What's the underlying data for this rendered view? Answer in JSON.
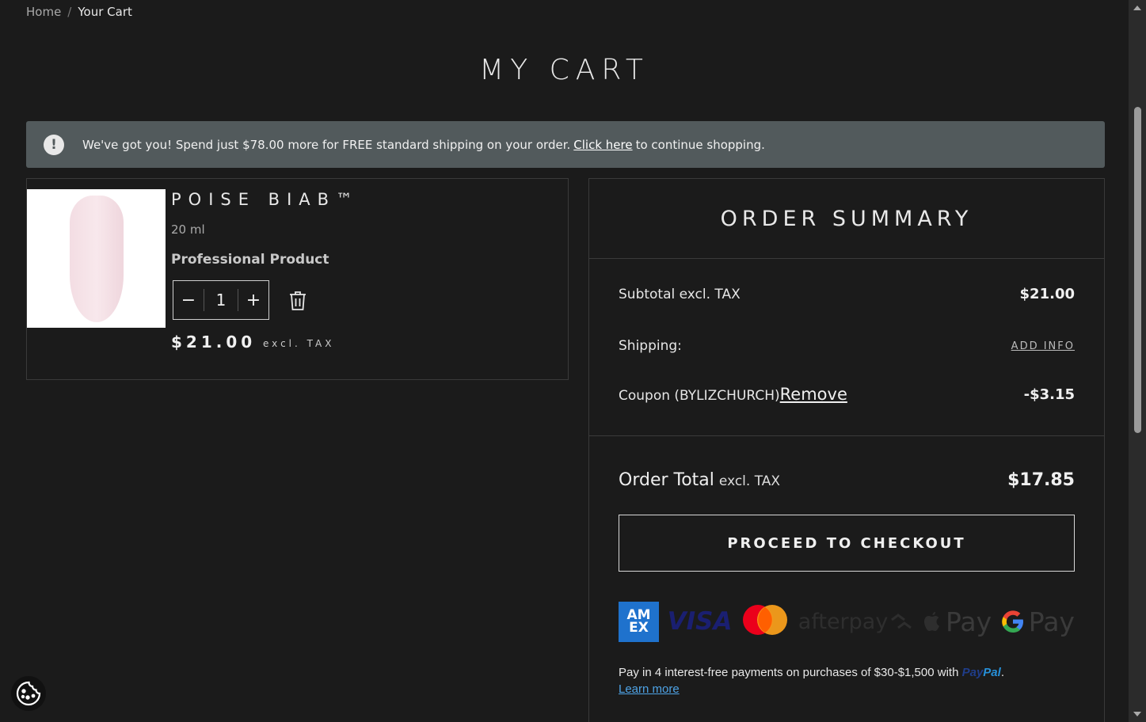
{
  "breadcrumb": {
    "home": "Home",
    "separator": "/",
    "current": "Your Cart"
  },
  "page": {
    "title": "MY CART"
  },
  "notice": {
    "icon": "exclamation-icon",
    "text_before": "We've got you! Spend just $78.00 more for FREE standard shipping on your order.",
    "link_text": "Click here",
    "text_after": "to continue shopping."
  },
  "cart": {
    "items": [
      {
        "name": "POISE BIAB™",
        "size": "20 ml",
        "type": "Professional Product",
        "quantity": "1",
        "decrement": "−",
        "increment": "+",
        "price": "$21.00",
        "price_note": "excl. TAX"
      }
    ]
  },
  "summary": {
    "title": "ORDER SUMMARY",
    "subtotal_label": "Subtotal excl. TAX",
    "subtotal_value": "$21.00",
    "shipping_label": "Shipping:",
    "shipping_action": "ADD INFO",
    "coupon_label": "Coupon (BYLIZCHURCH)",
    "coupon_remove": "Remove",
    "coupon_value": "-$3.15",
    "total_label": "Order Total",
    "total_note": "excl. TAX",
    "total_value": "$17.85",
    "checkout_label": "PROCEED TO CHECKOUT"
  },
  "payments": {
    "amex": "AM EX",
    "visa": "VISA",
    "afterpay": "afterpay",
    "applepay": "Pay",
    "gpay": "Pay",
    "paypal_text": "Pay in 4 interest-free payments on purchases of $30-$1,500 with",
    "paypal_pay": "Pay",
    "paypal_pal": "Pal",
    "paypal_period": ".",
    "learn_more": "Learn more"
  },
  "colors": {
    "background": "#1b1b1b",
    "notice_bg": "#525a5c",
    "amex_blue": "#1f72cd",
    "visa_blue": "#1a1f71",
    "paypal_blue": "#2790d8",
    "link_blue": "#4ea3e6"
  }
}
